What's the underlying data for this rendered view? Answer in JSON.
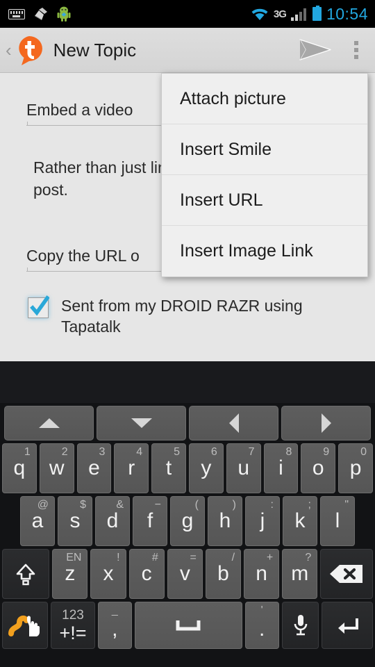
{
  "status_bar": {
    "left_icons": [
      "keyboard-icon",
      "broom-icon",
      "android-robot-icon"
    ],
    "right_icons": [
      "wifi-icon",
      "signal-icon",
      "battery-icon"
    ],
    "network_label": "3G",
    "clock": "10:54",
    "accent_color": "#22a7e0"
  },
  "action_bar": {
    "back_chevron": "‹",
    "app_icon": "tapatalk-logo",
    "title": "New Topic",
    "send_icon": "send-icon",
    "overflow_icon": "overflow-menu-icon"
  },
  "compose": {
    "subject_value": "Embed a video",
    "body_text": "Rather than just link, you can ea into your post.",
    "url_field_value": "Copy the URL o",
    "signature": {
      "checked": true,
      "label": "Sent from my DROID RAZR using Tapatalk"
    }
  },
  "overflow_menu": {
    "items": [
      {
        "label": "Attach picture"
      },
      {
        "label": "Insert Smile"
      },
      {
        "label": "Insert URL"
      },
      {
        "label": "Insert Image Link"
      }
    ]
  },
  "keyboard": {
    "nav_row": [
      {
        "name": "arrow-up",
        "glyph": "up"
      },
      {
        "name": "arrow-down",
        "glyph": "down"
      },
      {
        "name": "arrow-left",
        "glyph": "left"
      },
      {
        "name": "arrow-right",
        "glyph": "right"
      }
    ],
    "row1": [
      {
        "key": "q",
        "hint": "1"
      },
      {
        "key": "w",
        "hint": "2"
      },
      {
        "key": "e",
        "hint": "3"
      },
      {
        "key": "r",
        "hint": "4"
      },
      {
        "key": "t",
        "hint": "5"
      },
      {
        "key": "y",
        "hint": "6"
      },
      {
        "key": "u",
        "hint": "7"
      },
      {
        "key": "i",
        "hint": "8"
      },
      {
        "key": "o",
        "hint": "9"
      },
      {
        "key": "p",
        "hint": "0"
      }
    ],
    "row2": [
      {
        "key": "a",
        "hint": "@"
      },
      {
        "key": "s",
        "hint": "$"
      },
      {
        "key": "d",
        "hint": "&"
      },
      {
        "key": "f",
        "hint": "−"
      },
      {
        "key": "g",
        "hint": "("
      },
      {
        "key": "h",
        "hint": ")"
      },
      {
        "key": "j",
        "hint": ":"
      },
      {
        "key": "k",
        "hint": ";"
      },
      {
        "key": "l",
        "hint": "\""
      }
    ],
    "row3": {
      "shift": "shift-key",
      "keys": [
        {
          "key": "z",
          "hint": "EN"
        },
        {
          "key": "x",
          "hint": "!"
        },
        {
          "key": "c",
          "hint": "#"
        },
        {
          "key": "v",
          "hint": "="
        },
        {
          "key": "b",
          "hint": "/"
        },
        {
          "key": "n",
          "hint": "+"
        },
        {
          "key": "m",
          "hint": "?"
        }
      ],
      "backspace": "backspace-key"
    },
    "row4": {
      "swype": "swype-key",
      "symbols": {
        "hint": "123",
        "label": "+!="
      },
      "comma": {
        "hint": "_",
        "label": ","
      },
      "space": "space-key",
      "period": {
        "hint": "'",
        "label": "."
      },
      "mic": "microphone-key",
      "enter": "enter-key"
    }
  }
}
